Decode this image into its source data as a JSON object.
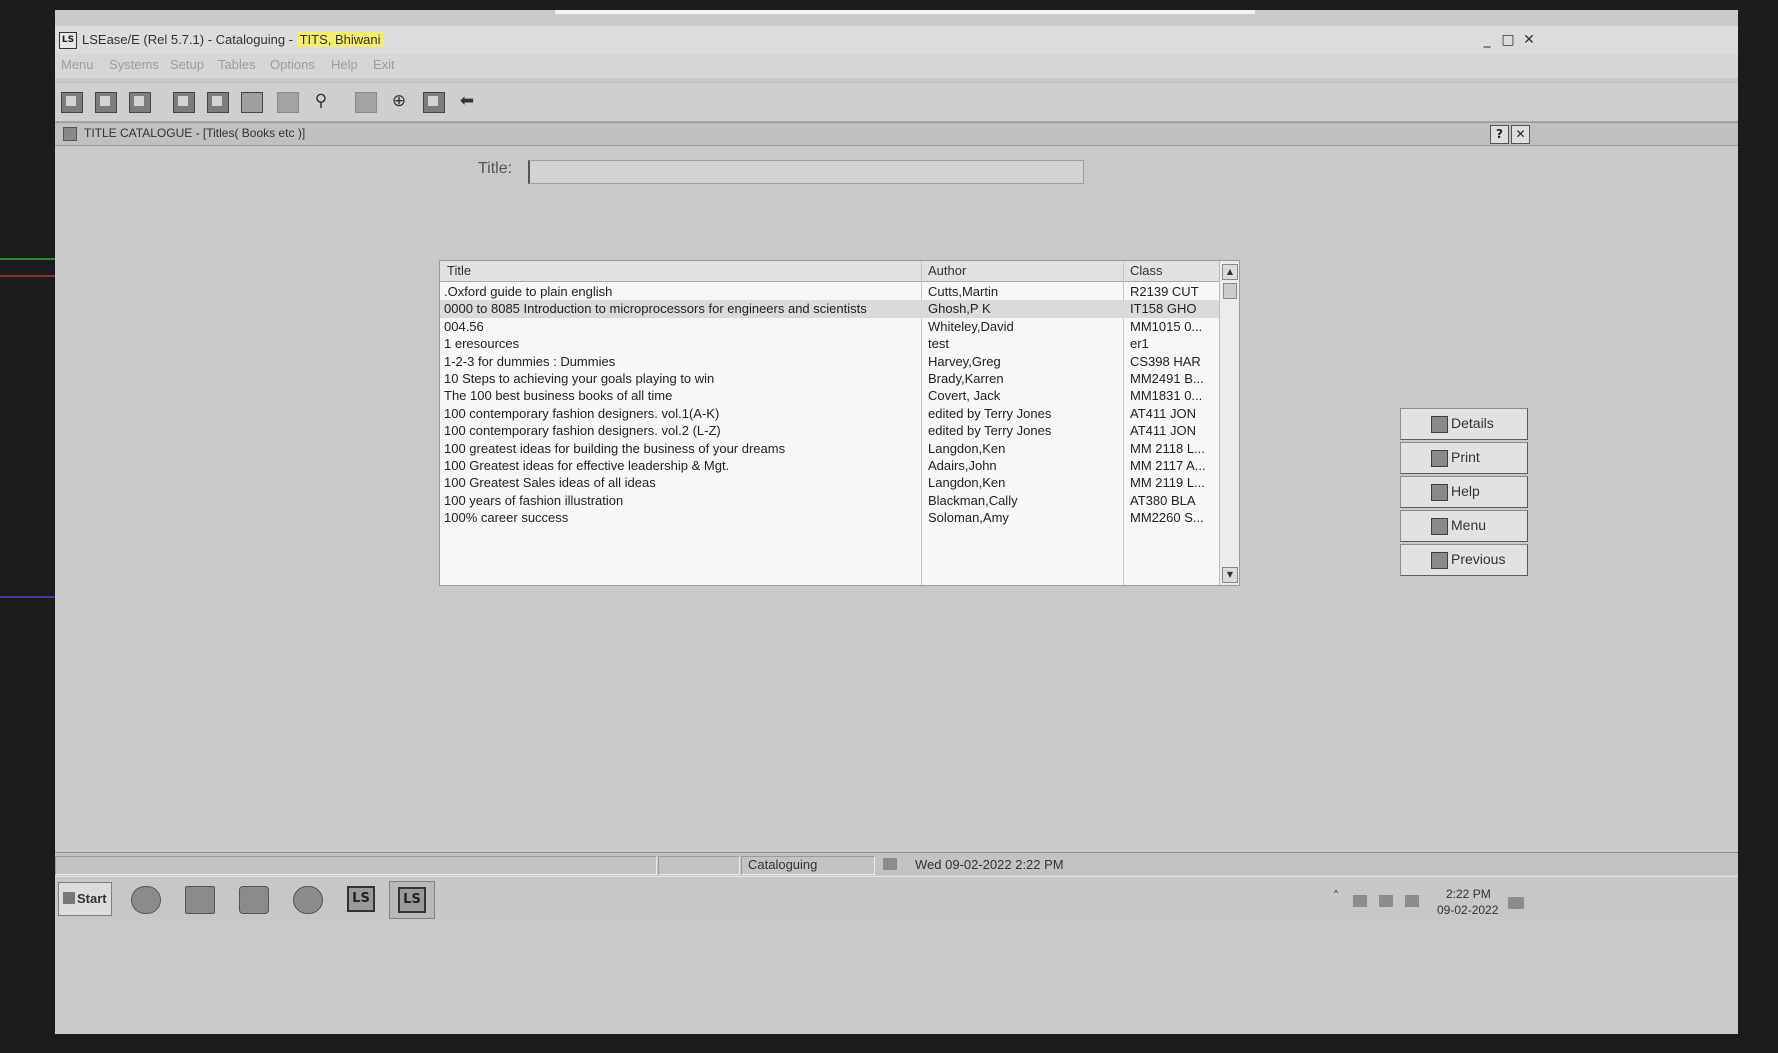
{
  "window": {
    "title": "LSEase/E (Rel 5.7.1) - Cataloguing - ",
    "title_highlight": "TITS, Bhiwani",
    "controls": [
      "_",
      "□",
      "✕"
    ]
  },
  "menu": [
    "Menu",
    "Systems",
    "Setup",
    "Tables",
    "Options",
    "Help",
    "Exit"
  ],
  "toolbar": {
    "icons": [
      "save-icon",
      "copy-icon",
      "paste-icon",
      "edit-icon",
      "edit2-icon",
      "blank-icon",
      "grey-icon",
      "search-icon",
      "grey2-icon",
      "globe-icon",
      "chart-icon",
      "back-arrow-icon"
    ]
  },
  "frame": {
    "title": "TITLE CATALOGUE - [Titles( Books etc )]",
    "help_label": "?",
    "close_label": "✕"
  },
  "search": {
    "label": "Title:",
    "value": ""
  },
  "grid": {
    "columns": [
      "Title",
      "Author",
      "Class"
    ],
    "rows": [
      {
        "title": ".Oxford guide to plain english",
        "author": "Cutts,Martin",
        "class": "R2139 CUT"
      },
      {
        "title": "0000 to 8085 Introduction to microprocessors for engineers and scientists",
        "author": "Ghosh,P K",
        "class": "IT158 GHO"
      },
      {
        "title": "004.56",
        "author": "Whiteley,David",
        "class": "MM1015 0..."
      },
      {
        "title": "1 eresources",
        "author": "test",
        "class": "er1"
      },
      {
        "title": "1-2-3 for dummies : Dummies",
        "author": "Harvey,Greg",
        "class": "CS398 HAR"
      },
      {
        "title": "10 Steps to achieving your goals playing to win",
        "author": "Brady,Karren",
        "class": "MM2491 B..."
      },
      {
        "title": "The 100 best business books of all time",
        "author": "Covert, Jack",
        "class": "MM1831 0..."
      },
      {
        "title": "100 contemporary fashion designers. vol.1(A-K)",
        "author": "edited by Terry Jones",
        "class": "AT411 JON"
      },
      {
        "title": "100 contemporary fashion designers. vol.2 (L-Z)",
        "author": "edited by Terry Jones",
        "class": "AT411 JON"
      },
      {
        "title": "100 greatest ideas for building the business of your dreams",
        "author": "Langdon,Ken",
        "class": "MM 2118 L..."
      },
      {
        "title": "100 Greatest ideas for effective leadership & Mgt.",
        "author": "Adairs,John",
        "class": "MM 2117 A..."
      },
      {
        "title": "100 Greatest Sales ideas of all ideas",
        "author": "Langdon,Ken",
        "class": "MM 2119 L..."
      },
      {
        "title": "100 years of fashion illustration",
        "author": "Blackman,Cally",
        "class": "AT380 BLA"
      },
      {
        "title": "100% career success",
        "author": "Soloman,Amy",
        "class": "MM2260 S..."
      }
    ],
    "selected_row": 1,
    "scroll_up": "▲",
    "scroll_down": "▼"
  },
  "side_buttons": [
    {
      "label": "Details",
      "icon": "details-icon"
    },
    {
      "label": "Print",
      "icon": "printer-icon"
    },
    {
      "label": "Help",
      "icon": "help-icon"
    },
    {
      "label": "Menu",
      "icon": "menu-icon"
    },
    {
      "label": "Previous",
      "icon": "previous-icon"
    }
  ],
  "status": {
    "module": "Cataloguing",
    "datetime": "Wed 09-02-2022 2:22 PM"
  },
  "taskbar": {
    "start_label": "Start",
    "app_labels": [
      "LS",
      "LS"
    ],
    "tray_up": "˄",
    "time": "2:22 PM",
    "date": "09-02-2022"
  },
  "colors": {
    "highlight": "#f3ec6f",
    "background": "#c9c9c9",
    "selected_row": "#dadada"
  }
}
